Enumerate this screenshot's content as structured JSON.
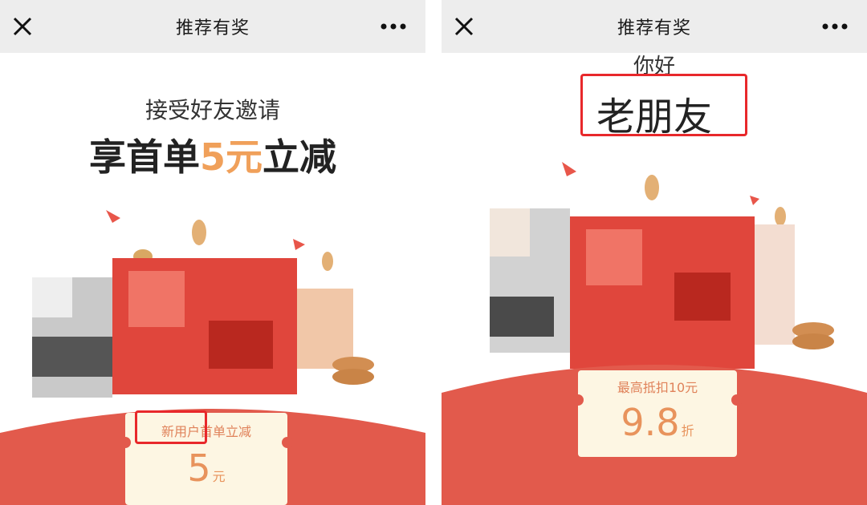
{
  "left": {
    "navbar": {
      "title": "推荐有奖",
      "close_icon": "close-icon",
      "more_icon": "more-icon"
    },
    "subtitle": "接受好友邀请",
    "headline": {
      "prefix": "享首单",
      "amount": "5元",
      "suffix": "立减"
    },
    "ticket": {
      "label": "新用户首单立减",
      "value": "5",
      "unit": "元"
    }
  },
  "right": {
    "navbar": {
      "title": "推荐有奖",
      "close_icon": "close-icon",
      "more_icon": "more-icon"
    },
    "greeting": "你好",
    "headline": "老朋友",
    "ticket": {
      "label": "最高抵扣10元",
      "value": "9.8",
      "unit": "折"
    }
  },
  "colors": {
    "envelope_red": "#e25a4c",
    "accent_orange": "#f0a05a",
    "highlight_red": "#e8282b",
    "ticket_bg": "#fdf6e3"
  }
}
